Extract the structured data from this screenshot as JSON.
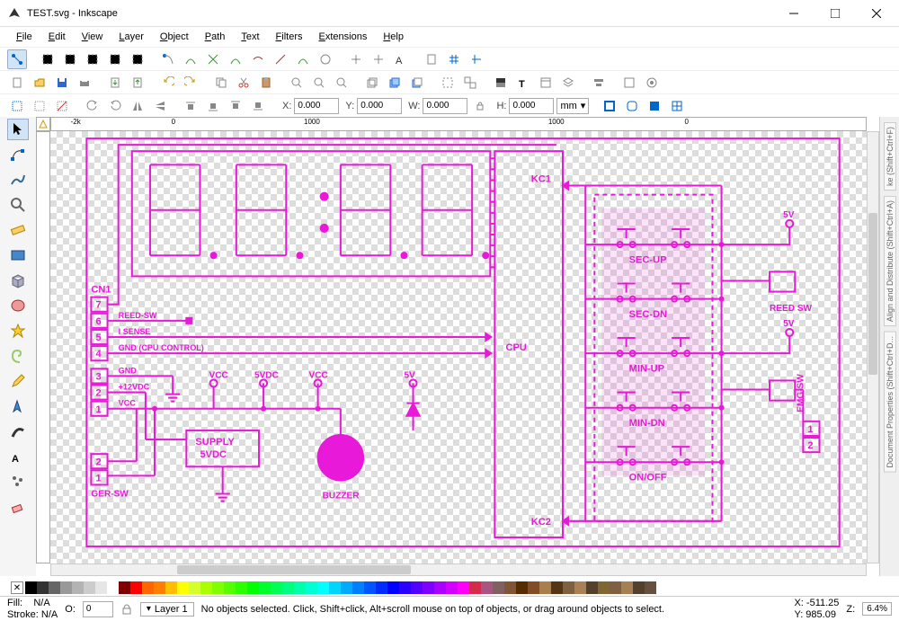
{
  "window": {
    "title": "TEST.svg - Inkscape"
  },
  "menu": [
    "File",
    "Edit",
    "View",
    "Layer",
    "Object",
    "Path",
    "Text",
    "Filters",
    "Extensions",
    "Help"
  ],
  "coords": {
    "x": "0.000",
    "y": "0.000",
    "w": "0.000",
    "h": "0.000",
    "unit": "mm"
  },
  "status": {
    "fill_label": "Fill:",
    "fill_value": "N/A",
    "stroke_label": "Stroke:",
    "stroke_value": "N/A",
    "opacity_label": "O:",
    "opacity_value": "0",
    "layer": "Layer 1",
    "hint": "No objects selected. Click, Shift+click, Alt+scroll mouse on top of objects, or drag around objects to select.",
    "coord_x": "X: -511.25",
    "coord_y": "Y:  985.09",
    "zoom_label": "Z:",
    "zoom": "6.4%"
  },
  "ruler_ticks": [
    "-2k",
    "0",
    "1000",
    "1000",
    "0"
  ],
  "schematic": {
    "labels": {
      "cn1": "CN1",
      "pins": [
        "7",
        "6",
        "5",
        "4",
        "3",
        "2",
        "1"
      ],
      "lower_pins": [
        "2",
        "1"
      ],
      "reed_sw": "REED-SW",
      "i_sense": "I SENSE",
      "gnd_cpu": "GND (CPU CONTROL)",
      "gnd": "GND",
      "p12v": "+12VDC",
      "vcc": "VCC",
      "ger_sw": "GER-SW",
      "supply_l1": "SUPPLY",
      "supply_l2": "5VDC",
      "buzzer": "BUZZER",
      "vcc1": "VCC",
      "v5dc": "5VDC",
      "vcc2": "VCC",
      "v5": "5V",
      "cpu": "CPU",
      "kc1": "KC1",
      "kc2": "KC2",
      "sec_up": "SEC-UP",
      "sec_dn": "SEC-DN",
      "min_up": "MIN-UP",
      "min_dn": "MIN-DN",
      "on_off": "ON/OFF",
      "r5v1": "5V",
      "r5v2": "5V",
      "reed_sw2": "REED SW",
      "emg_sw": "EMG-SW",
      "rpins": [
        "1",
        "2"
      ]
    }
  },
  "palette": [
    "#000",
    "#333",
    "#666",
    "#999",
    "#b3b3b3",
    "#ccc",
    "#e6e6e6",
    "#fff",
    "#800000",
    "#f00",
    "#ff6600",
    "#ff8000",
    "#ffbf00",
    "#ff0",
    "#d4ff2a",
    "#aaff00",
    "#80ff00",
    "#55ff00",
    "#2bff00",
    "#0f0",
    "#00ff2a",
    "#00ff55",
    "#00ff80",
    "#00ffaa",
    "#00ffd4",
    "#0ff",
    "#00d4ff",
    "#00aaff",
    "#0080ff",
    "#0055ff",
    "#002bff",
    "#00f",
    "#2a00ff",
    "#5500ff",
    "#8000ff",
    "#aa00ff",
    "#d400ff",
    "#f0f",
    "#d42b4d",
    "#aa557f",
    "#806060",
    "#805533",
    "#552b00",
    "#804d26",
    "#aa7f4d",
    "#553514",
    "#7f6040",
    "#aa8055",
    "#55402a",
    "#806633",
    "#806040",
    "#a68053",
    "#53402d",
    "#665040"
  ],
  "sidepanels": [
    "ke (Shift+Ctrl+F)",
    "Align and Distribute (Shift+Ctrl+A)",
    "Document Properties (Shift+Ctrl+D..."
  ]
}
